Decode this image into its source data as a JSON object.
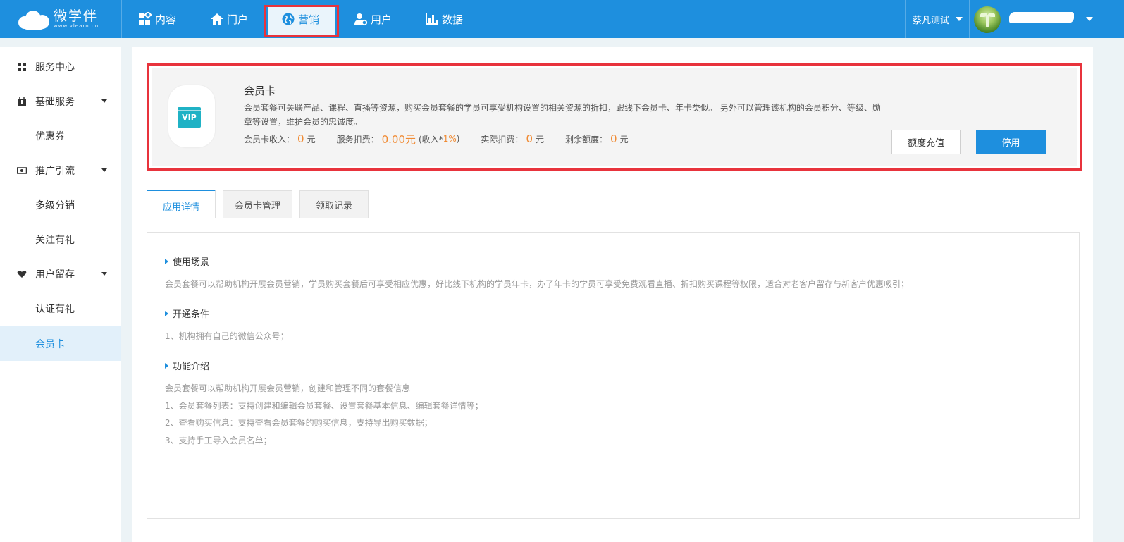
{
  "header": {
    "logo_name": "微学伴",
    "logo_url": "www.vlearn.cn",
    "nav": [
      {
        "label": "内容",
        "icon": "apps-grid-icon"
      },
      {
        "label": "门户",
        "icon": "home-icon"
      },
      {
        "label": "营销",
        "icon": "globe-icon"
      },
      {
        "label": "用户",
        "icon": "user-gear-icon"
      },
      {
        "label": "数据",
        "icon": "bar-chart-icon"
      }
    ],
    "org_name": "蔡凡测试"
  },
  "sidebar": {
    "items": [
      {
        "label": "服务中心",
        "icon": "grid-icon"
      },
      {
        "label": "基础服务",
        "icon": "briefcase-icon"
      },
      {
        "label": "优惠券"
      },
      {
        "label": "推广引流",
        "icon": "cash-icon"
      },
      {
        "label": "多级分销"
      },
      {
        "label": "关注有礼"
      },
      {
        "label": "用户留存",
        "icon": "heart-icon"
      },
      {
        "label": "认证有礼"
      },
      {
        "label": "会员卡"
      }
    ]
  },
  "card": {
    "badge": "VIP",
    "title": "会员卡",
    "description": "会员套餐可关联产品、课程、直播等资源，购买会员套餐的学员可享受机构设置的相关资源的折扣，跟线下会员卡、年卡类似。 另外可以管理该机构的会员积分、等级、勋章等设置，维护会员的忠诚度。",
    "stats": {
      "income_label": "会员卡收入：",
      "income_value": "0",
      "income_unit": "元",
      "fee_label": "服务扣费：",
      "fee_value": "0.00元",
      "fee_note_prefix": "(收入*",
      "fee_note_pct": "1%",
      "fee_note_suffix": ")",
      "actual_label": "实际扣费：",
      "actual_value": "0",
      "actual_unit": "元",
      "remain_label": "剩余额度：",
      "remain_value": "0",
      "remain_unit": "元"
    },
    "recharge_label": "额度充值",
    "disable_label": "停用"
  },
  "tabs": [
    "应用详情",
    "会员卡管理",
    "领取记录"
  ],
  "content": {
    "scene_title": "使用场景",
    "scene_text": "会员套餐可以帮助机构开展会员营销，学员购买套餐后可享受相应优惠，好比线下机构的学员年卡，办了年卡的学员可享受免费观看直播、折扣购买课程等权限，适合对老客户留存与新客户优惠吸引；",
    "cond_title": "开通条件",
    "cond_text": "1、机构拥有自己的微信公众号；",
    "func_title": "功能介绍",
    "func_lines": [
      "会员套餐可以帮助机构开展会员营销，创建和管理不同的套餐信息",
      "1、会员套餐列表：支持创建和编辑会员套餐、设置套餐基本信息、编辑套餐详情等；",
      "2、查看购买信息：支持查看会员套餐的购买信息，支持导出购买数据；",
      "3、支持手工导入会员名单；"
    ]
  },
  "colors": {
    "primary": "#1e8fde",
    "highlight_border": "#e8333c",
    "value_orange": "#f08a32"
  }
}
